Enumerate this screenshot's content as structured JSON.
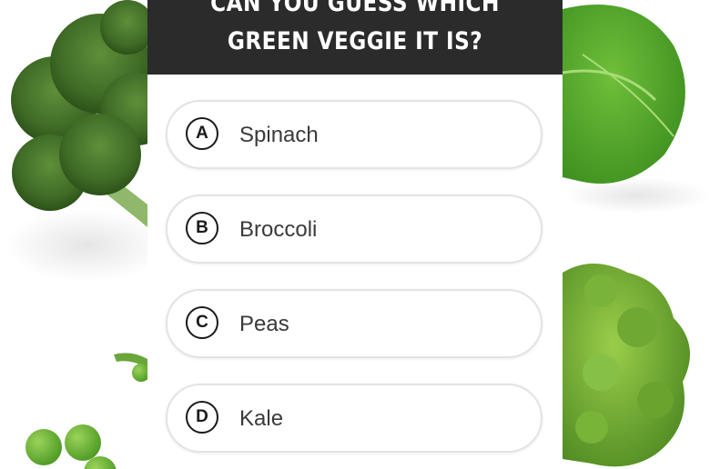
{
  "header": {
    "line1": "CAN YOU GUESS WHICH",
    "line2": "GREEN VEGGIE IT IS?"
  },
  "options": [
    {
      "letter": "A",
      "label": "Spinach"
    },
    {
      "letter": "B",
      "label": "Broccoli"
    },
    {
      "letter": "C",
      "label": "Peas"
    },
    {
      "letter": "D",
      "label": "Kale"
    }
  ],
  "colors": {
    "header_bg": "#2b2b2b",
    "header_text": "#ffffff",
    "option_border": "#e3e3e3",
    "letter_ring": "#1a1a1a",
    "veggie_green": "#4e8a2e"
  }
}
